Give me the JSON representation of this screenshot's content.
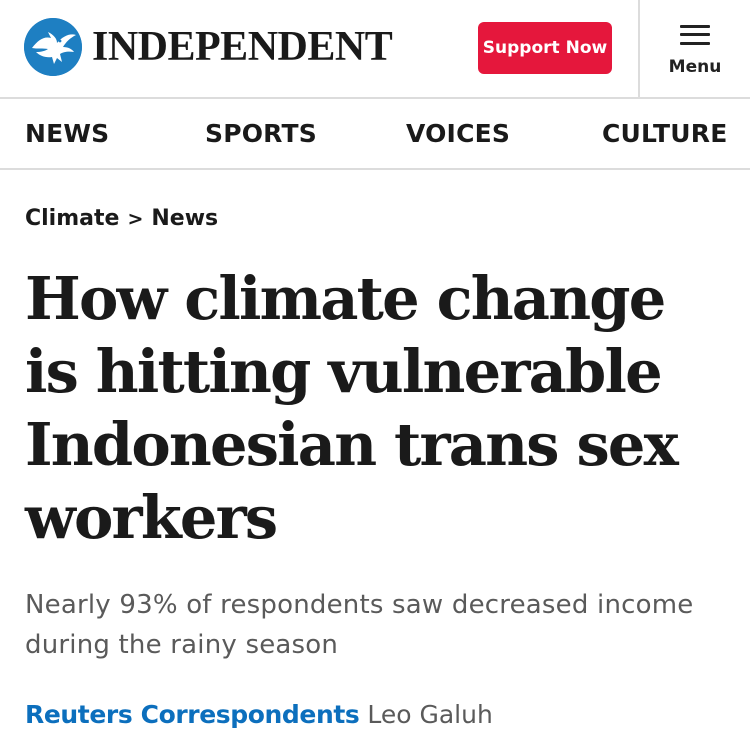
{
  "header": {
    "logo_text": "INDEPENDENT",
    "support_label": "Support Now",
    "menu_label": "Menu",
    "logo_icon": "eagle-icon",
    "menu_icon": "hamburger-icon"
  },
  "colors": {
    "brand_blue": "#1e7fc2",
    "support_red": "#e5173c",
    "link_blue": "#0c6fbd",
    "text": "#1a1a1a",
    "muted_text": "#5a5a5a",
    "divider": "#dcdcdc"
  },
  "nav": {
    "items": [
      {
        "label": "NEWS"
      },
      {
        "label": "SPORTS"
      },
      {
        "label": "VOICES"
      },
      {
        "label": "CULTURE"
      }
    ]
  },
  "breadcrumb": {
    "section": "Climate",
    "separator": ">",
    "subsection": "News"
  },
  "article": {
    "headline": "How climate change is hitting vulnerable Indonesian trans sex workers",
    "subtitle": "Nearly 93% of respondents saw decreased income during the rainy season",
    "byline": {
      "author_link": "Reuters Correspondents",
      "author_name": "Leo Galuh"
    }
  }
}
